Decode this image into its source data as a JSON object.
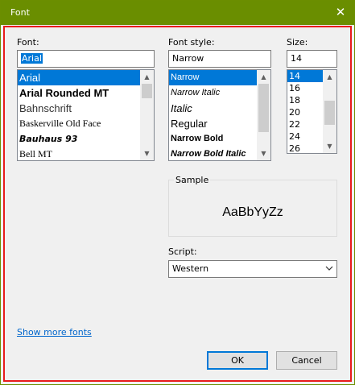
{
  "window": {
    "title": "Font",
    "close_glyph": "✕",
    "titlebar_color": "#6a8e00",
    "highlight_frame_color": "#e81b1b"
  },
  "font": {
    "label": "Font:",
    "value": "Arial",
    "items": [
      {
        "label": "Arial",
        "selected": true
      },
      {
        "label": "Arial Rounded MT",
        "selected": false
      },
      {
        "label": "Bahnschrift",
        "selected": false
      },
      {
        "label": "Baskerville Old Face",
        "selected": false
      },
      {
        "label": "Bauhaus 93",
        "selected": false
      },
      {
        "label": "Bell MT",
        "selected": false
      }
    ]
  },
  "style": {
    "label": "Font style:",
    "value": "Narrow",
    "items": [
      {
        "label": "Narrow",
        "selected": true
      },
      {
        "label": "Narrow Italic",
        "selected": false
      },
      {
        "label": "Italic",
        "selected": false
      },
      {
        "label": "Regular",
        "selected": false
      },
      {
        "label": "Narrow Bold",
        "selected": false
      },
      {
        "label": "Narrow Bold Italic",
        "selected": false
      }
    ]
  },
  "size": {
    "label": "Size:",
    "value": "14",
    "items": [
      {
        "label": "14",
        "selected": true
      },
      {
        "label": "16",
        "selected": false
      },
      {
        "label": "18",
        "selected": false
      },
      {
        "label": "20",
        "selected": false
      },
      {
        "label": "22",
        "selected": false
      },
      {
        "label": "24",
        "selected": false
      },
      {
        "label": "26",
        "selected": false
      }
    ]
  },
  "sample": {
    "label": "Sample",
    "text": "AaBbYyZz"
  },
  "script": {
    "label": "Script:",
    "value": "Western"
  },
  "show_more_fonts": "Show more fonts",
  "buttons": {
    "ok": "OK",
    "cancel": "Cancel"
  },
  "icons": {
    "scroll_up": "▲",
    "scroll_down": "▼",
    "dropdown": "⌄"
  }
}
